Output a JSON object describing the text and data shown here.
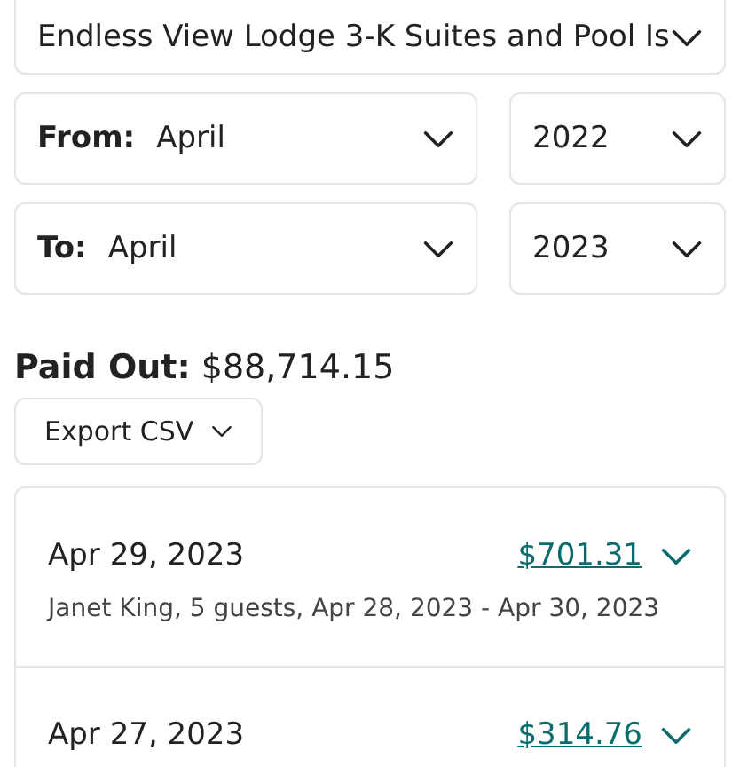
{
  "listing_select": {
    "value": "Endless View Lodge 3-K Suites and Pool Is"
  },
  "from": {
    "label": "From:",
    "month": "April",
    "year": "2022"
  },
  "to": {
    "label": "To:",
    "month": "April",
    "year": "2023"
  },
  "paid_out": {
    "label": "Paid Out:",
    "amount": "$88,714.15"
  },
  "export_button": {
    "label": "Export CSV"
  },
  "payouts": [
    {
      "date": "Apr 29, 2023",
      "amount": "$701.31",
      "details": "Janet King, 5 guests, Apr 28, 2023 - Apr 30, 2023"
    },
    {
      "date": "Apr 27, 2023",
      "amount": "$314.76"
    }
  ]
}
